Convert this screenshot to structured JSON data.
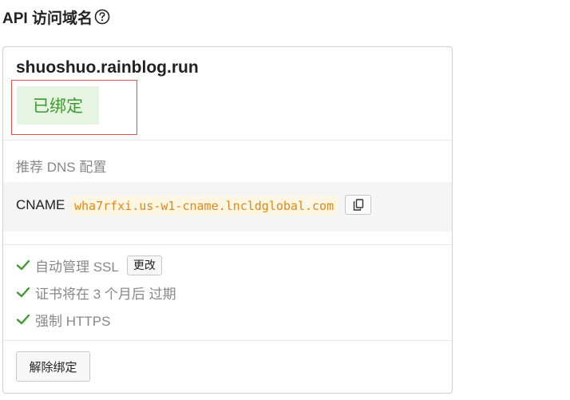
{
  "header": {
    "title": "API 访问域名",
    "help_icon": "question-circle-icon"
  },
  "card": {
    "domain": "shuoshuo.rainblog.run",
    "status": "已绑定",
    "dns_heading": "推荐 DNS 配置",
    "dns_record": {
      "type": "CNAME",
      "value": "wha7rfxi.us-w1-cname.lncldglobal.com",
      "copy_icon": "copy-icon"
    },
    "features": [
      {
        "text": "自动管理 SSL",
        "action_label": "更改",
        "icon": "check-icon"
      },
      {
        "text": "证书将在 3 个月后 过期",
        "icon": "check-icon"
      },
      {
        "text": "强制 HTTPS",
        "icon": "check-icon"
      }
    ],
    "unbind_label": "解除绑定"
  },
  "colors": {
    "success_green": "#3c9a2e",
    "badge_bg": "#e6f5e1",
    "highlight_red": "#d9534f",
    "code_orange": "#d88a1d"
  }
}
